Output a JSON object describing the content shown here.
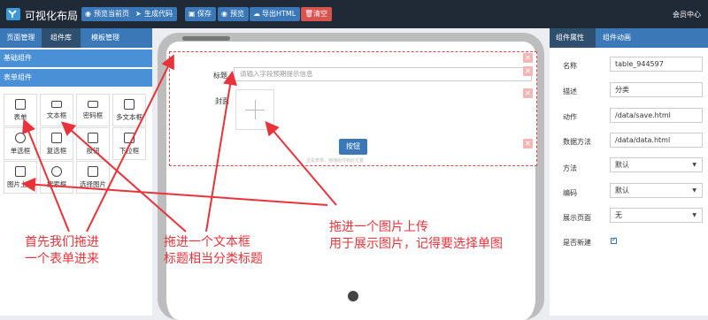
{
  "app": {
    "title": "可视化布局"
  },
  "toolbar": {
    "preview_page": "预览当前页",
    "generate_code": "生成代码",
    "save": "保存",
    "preview": "预览",
    "export_html": "导出HTML",
    "clear": "清空",
    "user_center": "会员中心"
  },
  "left": {
    "tabs": [
      "页面管理",
      "组件库",
      "模板管理"
    ],
    "sections": [
      "基础组件",
      "表单组件"
    ],
    "components": [
      "表单",
      "文本框",
      "密码框",
      "多文本框",
      "单选框",
      "复选框",
      "按钮",
      "下拉框",
      "图片上传",
      "搜索框",
      "选择图片"
    ]
  },
  "canvas": {
    "title_label": "标题",
    "title_placeholder": "请输入字段预期提示信息",
    "cover_label": "封面",
    "submit_label": "按钮",
    "hint": "这是表单，拖拽组件到此位置"
  },
  "right": {
    "tabs": [
      "组件属性",
      "组件动画"
    ],
    "props": [
      {
        "label": "名称",
        "value": "table_944597"
      },
      {
        "label": "描述",
        "value": "分类"
      },
      {
        "label": "动作",
        "value": "/data/save.html"
      },
      {
        "label": "数据方法",
        "value": "/data/data.html"
      },
      {
        "label": "方法",
        "value": "默认"
      },
      {
        "label": "编码",
        "value": "默认"
      },
      {
        "label": "展示页面",
        "value": "无"
      }
    ],
    "new_label": "是否新建"
  },
  "annotations": {
    "a1_line1": "首先我们拖进",
    "a1_line2": "一个表单进来",
    "a2_line1": "拖进一个文本框",
    "a2_line2": "标题相当分类标题",
    "a3_line1": "拖进一个图片上传",
    "a3_line2": "用于展示图片，记得要选择单图"
  },
  "colors": {
    "topbar": "#1f2a36",
    "accent": "#3a78b8",
    "annotation": "#e8333a"
  }
}
